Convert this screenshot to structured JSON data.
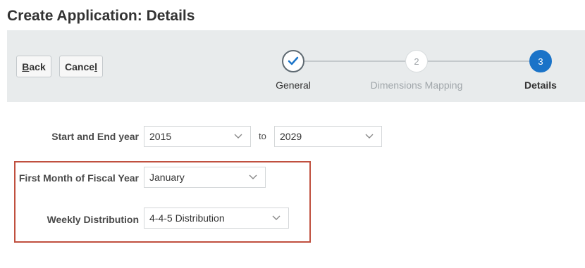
{
  "page": {
    "title": "Create Application: Details"
  },
  "toolbar": {
    "back_label_accel": "B",
    "back_label_rest": "ack",
    "cancel_label_start": "Cance",
    "cancel_label_accel": "l"
  },
  "train": {
    "steps": [
      {
        "number": "",
        "label": "General",
        "state": "done",
        "icon": "checkmark-icon"
      },
      {
        "number": "2",
        "label": "Dimensions Mapping",
        "state": "pending"
      },
      {
        "number": "3",
        "label": "Details",
        "state": "current"
      }
    ]
  },
  "form": {
    "years": {
      "label": "Start and End year",
      "start_value": "2015",
      "to_label": "to",
      "end_value": "2029"
    },
    "fiscal_month": {
      "label": "First Month of Fiscal Year",
      "value": "January"
    },
    "weekly_distribution": {
      "label": "Weekly Distribution",
      "value": "4-4-5 Distribution"
    }
  },
  "colors": {
    "accent": "#1a73c8",
    "highlight_border": "#c0503f",
    "train_background": "#e8ebec"
  }
}
